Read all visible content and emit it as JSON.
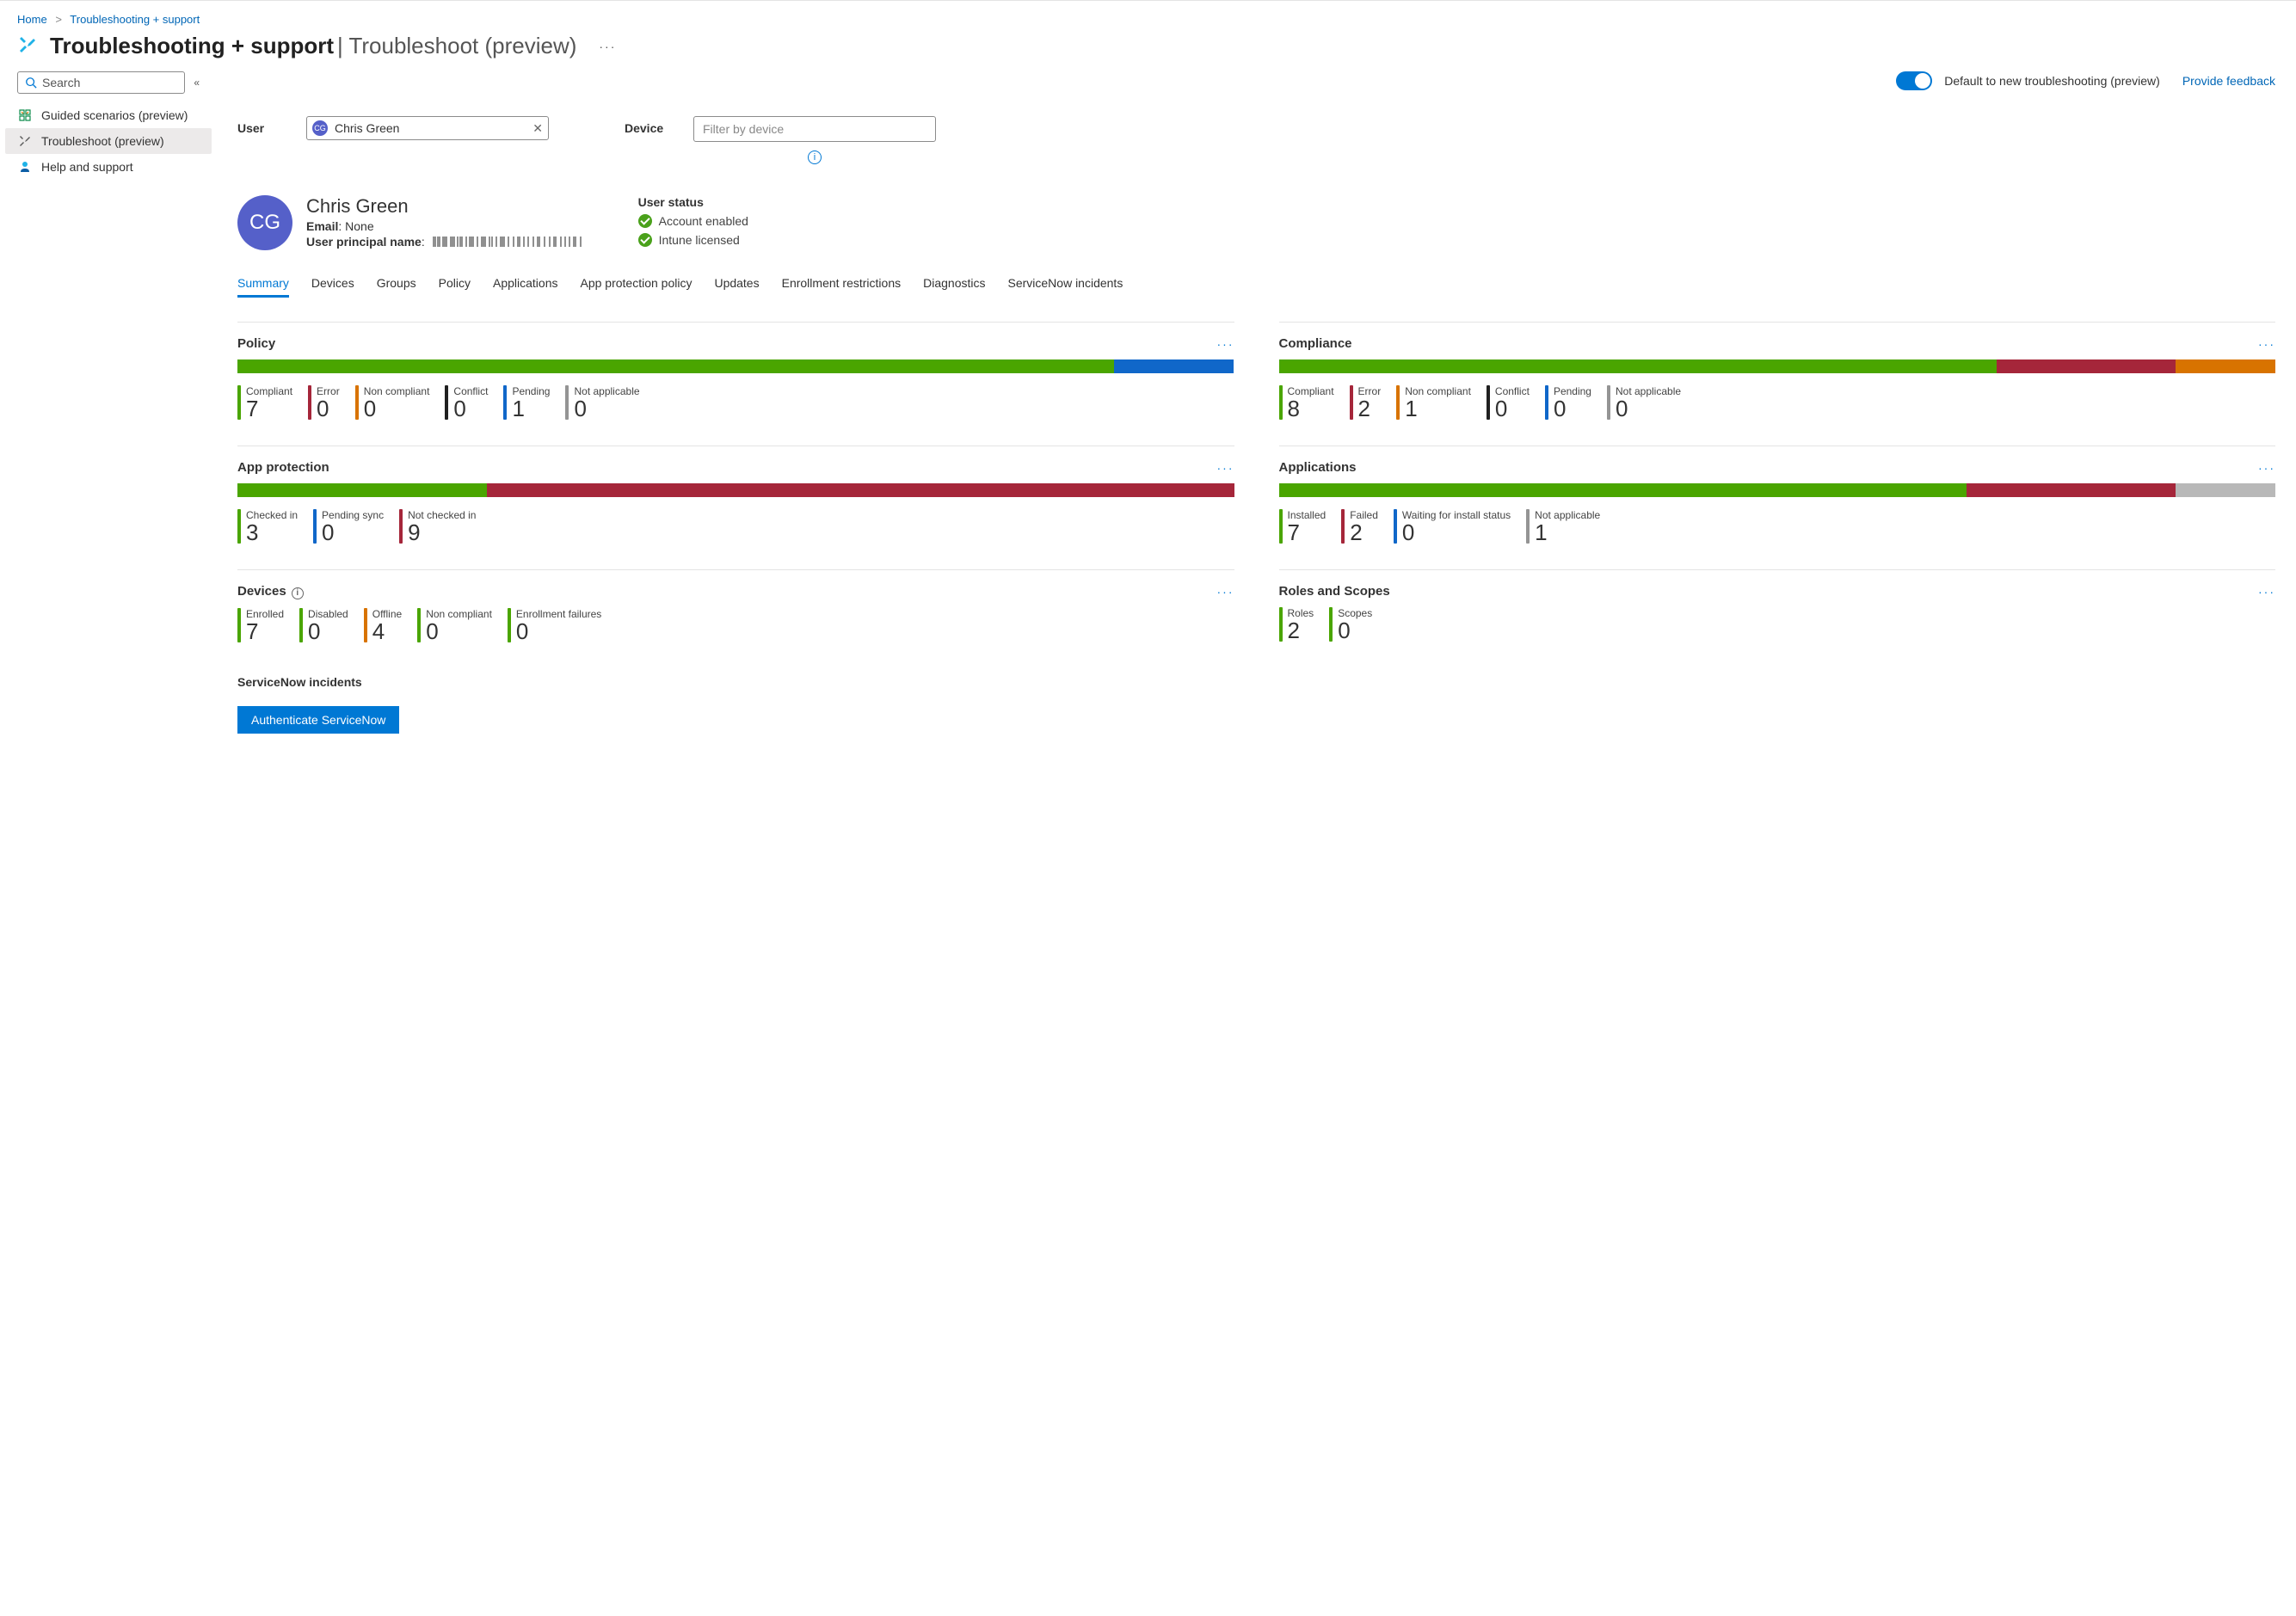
{
  "breadcrumb": {
    "home": "Home",
    "current": "Troubleshooting + support"
  },
  "title": {
    "main": "Troubleshooting + support",
    "sub": "Troubleshoot (preview)"
  },
  "sidebar": {
    "search_placeholder": "Search",
    "items": [
      {
        "label": "Guided scenarios (preview)"
      },
      {
        "label": "Troubleshoot (preview)"
      },
      {
        "label": "Help and support"
      }
    ]
  },
  "toolbar": {
    "toggle_label": "Default to new troubleshooting (preview)",
    "feedback": "Provide feedback"
  },
  "filters": {
    "user_label": "User",
    "user_value": "Chris Green",
    "user_initials": "CG",
    "device_label": "Device",
    "device_placeholder": "Filter by device"
  },
  "user": {
    "initials": "CG",
    "name": "Chris Green",
    "email_label": "Email",
    "email_value": "None",
    "upn_label": "User principal name",
    "status_heading": "User status",
    "status": [
      "Account enabled",
      "Intune licensed"
    ]
  },
  "tabs": [
    "Summary",
    "Devices",
    "Groups",
    "Policy",
    "Applications",
    "App protection policy",
    "Updates",
    "Enrollment restrictions",
    "Diagnostics",
    "ServiceNow incidents"
  ],
  "cards": {
    "policy": {
      "title": "Policy",
      "bar": [
        {
          "c": "c-green",
          "w": 88
        },
        {
          "c": "c-blue",
          "w": 12
        }
      ],
      "metrics": [
        {
          "label": "Compliant",
          "value": "7",
          "c": "c-green"
        },
        {
          "label": "Error",
          "value": "0",
          "c": "c-red"
        },
        {
          "label": "Non compliant",
          "value": "0",
          "c": "c-orange"
        },
        {
          "label": "Conflict",
          "value": "0",
          "c": "c-black"
        },
        {
          "label": "Pending",
          "value": "1",
          "c": "c-blue"
        },
        {
          "label": "Not applicable",
          "value": "0",
          "c": "c-gray"
        }
      ]
    },
    "compliance": {
      "title": "Compliance",
      "bar": [
        {
          "c": "c-green",
          "w": 72
        },
        {
          "c": "c-red",
          "w": 18
        },
        {
          "c": "c-orange",
          "w": 10
        }
      ],
      "metrics": [
        {
          "label": "Compliant",
          "value": "8",
          "c": "c-green"
        },
        {
          "label": "Error",
          "value": "2",
          "c": "c-red"
        },
        {
          "label": "Non compliant",
          "value": "1",
          "c": "c-orange"
        },
        {
          "label": "Conflict",
          "value": "0",
          "c": "c-black"
        },
        {
          "label": "Pending",
          "value": "0",
          "c": "c-blue"
        },
        {
          "label": "Not applicable",
          "value": "0",
          "c": "c-gray"
        }
      ]
    },
    "app_protection": {
      "title": "App protection",
      "bar": [
        {
          "c": "c-green",
          "w": 25
        },
        {
          "c": "c-red",
          "w": 75
        }
      ],
      "metrics": [
        {
          "label": "Checked in",
          "value": "3",
          "c": "c-green"
        },
        {
          "label": "Pending sync",
          "value": "0",
          "c": "c-blue"
        },
        {
          "label": "Not checked in",
          "value": "9",
          "c": "c-red"
        }
      ]
    },
    "applications": {
      "title": "Applications",
      "bar": [
        {
          "c": "c-green",
          "w": 69
        },
        {
          "c": "c-red",
          "w": 21
        },
        {
          "c": "c-lgray",
          "w": 10
        }
      ],
      "metrics": [
        {
          "label": "Installed",
          "value": "7",
          "c": "c-green"
        },
        {
          "label": "Failed",
          "value": "2",
          "c": "c-red"
        },
        {
          "label": "Waiting for install status",
          "value": "0",
          "c": "c-blue"
        },
        {
          "label": "Not applicable",
          "value": "1",
          "c": "c-gray"
        }
      ]
    },
    "devices": {
      "title": "Devices",
      "info": true,
      "metrics": [
        {
          "label": "Enrolled",
          "value": "7",
          "c": "c-green"
        },
        {
          "label": "Disabled",
          "value": "0",
          "c": "c-green"
        },
        {
          "label": "Offline",
          "value": "4",
          "c": "c-orange"
        },
        {
          "label": "Non compliant",
          "value": "0",
          "c": "c-green"
        },
        {
          "label": "Enrollment failures",
          "value": "0",
          "c": "c-green"
        }
      ]
    },
    "roles": {
      "title": "Roles and Scopes",
      "metrics": [
        {
          "label": "Roles",
          "value": "2",
          "c": "c-green"
        },
        {
          "label": "Scopes",
          "value": "0",
          "c": "c-green"
        }
      ]
    }
  },
  "servicenow": {
    "title": "ServiceNow incidents",
    "button": "Authenticate ServiceNow"
  },
  "chart_data": [
    {
      "type": "bar",
      "title": "Policy",
      "categories": [
        "Compliant",
        "Error",
        "Non compliant",
        "Conflict",
        "Pending",
        "Not applicable"
      ],
      "values": [
        7,
        0,
        0,
        0,
        1,
        0
      ]
    },
    {
      "type": "bar",
      "title": "Compliance",
      "categories": [
        "Compliant",
        "Error",
        "Non compliant",
        "Conflict",
        "Pending",
        "Not applicable"
      ],
      "values": [
        8,
        2,
        1,
        0,
        0,
        0
      ]
    },
    {
      "type": "bar",
      "title": "App protection",
      "categories": [
        "Checked in",
        "Pending sync",
        "Not checked in"
      ],
      "values": [
        3,
        0,
        9
      ]
    },
    {
      "type": "bar",
      "title": "Applications",
      "categories": [
        "Installed",
        "Failed",
        "Waiting for install status",
        "Not applicable"
      ],
      "values": [
        7,
        2,
        0,
        1
      ]
    },
    {
      "type": "bar",
      "title": "Devices",
      "categories": [
        "Enrolled",
        "Disabled",
        "Offline",
        "Non compliant",
        "Enrollment failures"
      ],
      "values": [
        7,
        0,
        4,
        0,
        0
      ]
    },
    {
      "type": "bar",
      "title": "Roles and Scopes",
      "categories": [
        "Roles",
        "Scopes"
      ],
      "values": [
        2,
        0
      ]
    }
  ]
}
